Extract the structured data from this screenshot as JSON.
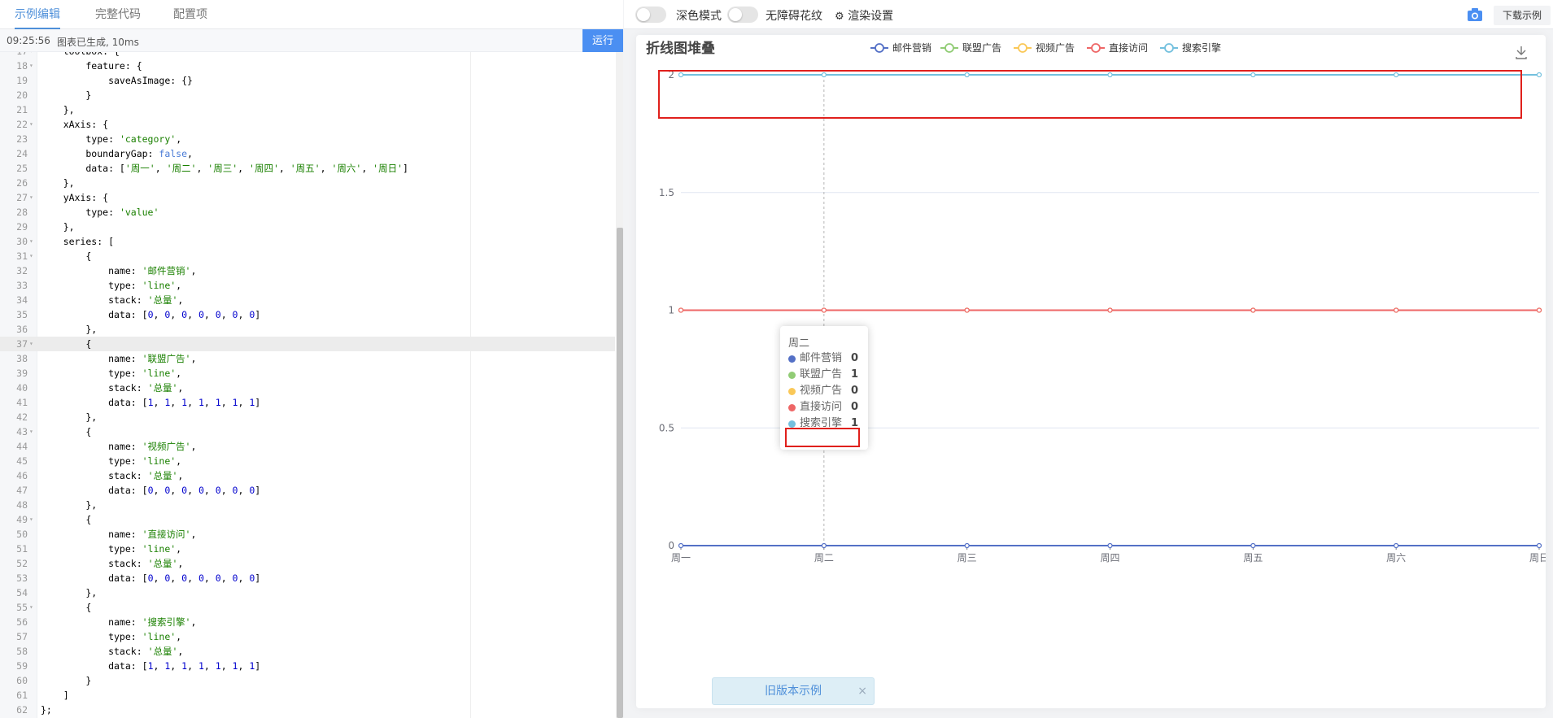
{
  "tabs": [
    {
      "label": "示例编辑",
      "active": true
    },
    {
      "label": "完整代码",
      "active": false
    },
    {
      "label": "配置项",
      "active": false
    }
  ],
  "status": {
    "time": "09:25:56",
    "message": "图表已生成, 10ms",
    "run_label": "运行"
  },
  "code_lines": [
    {
      "n": "17",
      "fold": true,
      "text": "    toolbox: {"
    },
    {
      "n": "18",
      "fold": true,
      "text": "        feature: {"
    },
    {
      "n": "19",
      "fold": false,
      "text": "            saveAsImage: {}"
    },
    {
      "n": "20",
      "fold": false,
      "text": "        }"
    },
    {
      "n": "21",
      "fold": false,
      "text": "    },"
    },
    {
      "n": "22",
      "fold": true,
      "text": "    xAxis: {"
    },
    {
      "n": "23",
      "fold": false,
      "text": "        type: 'category',"
    },
    {
      "n": "24",
      "fold": false,
      "text": "        boundaryGap: false,"
    },
    {
      "n": "25",
      "fold": false,
      "text": "        data: ['周一', '周二', '周三', '周四', '周五', '周六', '周日']"
    },
    {
      "n": "26",
      "fold": false,
      "text": "    },"
    },
    {
      "n": "27",
      "fold": true,
      "text": "    yAxis: {"
    },
    {
      "n": "28",
      "fold": false,
      "text": "        type: 'value'"
    },
    {
      "n": "29",
      "fold": false,
      "text": "    },"
    },
    {
      "n": "30",
      "fold": true,
      "text": "    series: ["
    },
    {
      "n": "31",
      "fold": true,
      "text": "        {"
    },
    {
      "n": "32",
      "fold": false,
      "text": "            name: '邮件营销',"
    },
    {
      "n": "33",
      "fold": false,
      "text": "            type: 'line',"
    },
    {
      "n": "34",
      "fold": false,
      "text": "            stack: '总量',"
    },
    {
      "n": "35",
      "fold": false,
      "text": "            data: [0, 0, 0, 0, 0, 0, 0]"
    },
    {
      "n": "36",
      "fold": false,
      "text": "        },"
    },
    {
      "n": "37",
      "fold": true,
      "text": "        {",
      "active": true
    },
    {
      "n": "38",
      "fold": false,
      "text": "            name: '联盟广告',"
    },
    {
      "n": "39",
      "fold": false,
      "text": "            type: 'line',"
    },
    {
      "n": "40",
      "fold": false,
      "text": "            stack: '总量',"
    },
    {
      "n": "41",
      "fold": false,
      "text": "            data: [1, 1, 1, 1, 1, 1, 1]"
    },
    {
      "n": "42",
      "fold": false,
      "text": "        },"
    },
    {
      "n": "43",
      "fold": true,
      "text": "        {"
    },
    {
      "n": "44",
      "fold": false,
      "text": "            name: '视频广告',"
    },
    {
      "n": "45",
      "fold": false,
      "text": "            type: 'line',"
    },
    {
      "n": "46",
      "fold": false,
      "text": "            stack: '总量',"
    },
    {
      "n": "47",
      "fold": false,
      "text": "            data: [0, 0, 0, 0, 0, 0, 0]"
    },
    {
      "n": "48",
      "fold": false,
      "text": "        },"
    },
    {
      "n": "49",
      "fold": true,
      "text": "        {"
    },
    {
      "n": "50",
      "fold": false,
      "text": "            name: '直接访问',"
    },
    {
      "n": "51",
      "fold": false,
      "text": "            type: 'line',"
    },
    {
      "n": "52",
      "fold": false,
      "text": "            stack: '总量',"
    },
    {
      "n": "53",
      "fold": false,
      "text": "            data: [0, 0, 0, 0, 0, 0, 0]"
    },
    {
      "n": "54",
      "fold": false,
      "text": "        },"
    },
    {
      "n": "55",
      "fold": true,
      "text": "        {"
    },
    {
      "n": "56",
      "fold": false,
      "text": "            name: '搜索引擎',"
    },
    {
      "n": "57",
      "fold": false,
      "text": "            type: 'line',"
    },
    {
      "n": "58",
      "fold": false,
      "text": "            stack: '总量',"
    },
    {
      "n": "59",
      "fold": false,
      "text": "            data: [1, 1, 1, 1, 1, 1, 1]"
    },
    {
      "n": "60",
      "fold": false,
      "text": "        }"
    },
    {
      "n": "61",
      "fold": false,
      "text": "    ]"
    },
    {
      "n": "62",
      "fold": false,
      "text": "};"
    }
  ],
  "topbar": {
    "dark_mode_label": "深色模式",
    "accessibility_label": "无障碍花纹",
    "render_settings_label": "渲染设置",
    "download_label": "下载示例"
  },
  "tooltip": {
    "title": "周二",
    "rows": [
      {
        "name": "邮件营销",
        "value": "0"
      },
      {
        "name": "联盟广告",
        "value": "1"
      },
      {
        "name": "视频广告",
        "value": "0"
      },
      {
        "name": "直接访问",
        "value": "0"
      },
      {
        "name": "搜索引擎",
        "value": "1"
      }
    ]
  },
  "old_version": {
    "label": "旧版本示例",
    "close": "×"
  },
  "colors": {
    "accent": "#4e8fd9",
    "highlight_box": "#e0201c",
    "series": [
      "#5470c6",
      "#91cc75",
      "#fac858",
      "#ee6666",
      "#73c0de"
    ]
  },
  "chart_data": {
    "type": "line",
    "title": "折线图堆叠",
    "categories": [
      "周一",
      "周二",
      "周三",
      "周四",
      "周五",
      "周六",
      "周日"
    ],
    "series": [
      {
        "name": "邮件营销",
        "values": [
          0,
          0,
          0,
          0,
          0,
          0,
          0
        ],
        "stacked": [
          0,
          0,
          0,
          0,
          0,
          0,
          0
        ]
      },
      {
        "name": "联盟广告",
        "values": [
          1,
          1,
          1,
          1,
          1,
          1,
          1
        ],
        "stacked": [
          1,
          1,
          1,
          1,
          1,
          1,
          1
        ]
      },
      {
        "name": "视频广告",
        "values": [
          0,
          0,
          0,
          0,
          0,
          0,
          0
        ],
        "stacked": [
          1,
          1,
          1,
          1,
          1,
          1,
          1
        ]
      },
      {
        "name": "直接访问",
        "values": [
          0,
          0,
          0,
          0,
          0,
          0,
          0
        ],
        "stacked": [
          1,
          1,
          1,
          1,
          1,
          1,
          1
        ]
      },
      {
        "name": "搜索引擎",
        "values": [
          1,
          1,
          1,
          1,
          1,
          1,
          1
        ],
        "stacked": [
          2,
          2,
          2,
          2,
          2,
          2,
          2
        ]
      }
    ],
    "y_ticks": [
      "0",
      "0.5",
      "1",
      "1.5",
      "2"
    ],
    "ylim": [
      0,
      2
    ],
    "grid": true,
    "legend_position": "top-center",
    "hover_category": "周二"
  }
}
